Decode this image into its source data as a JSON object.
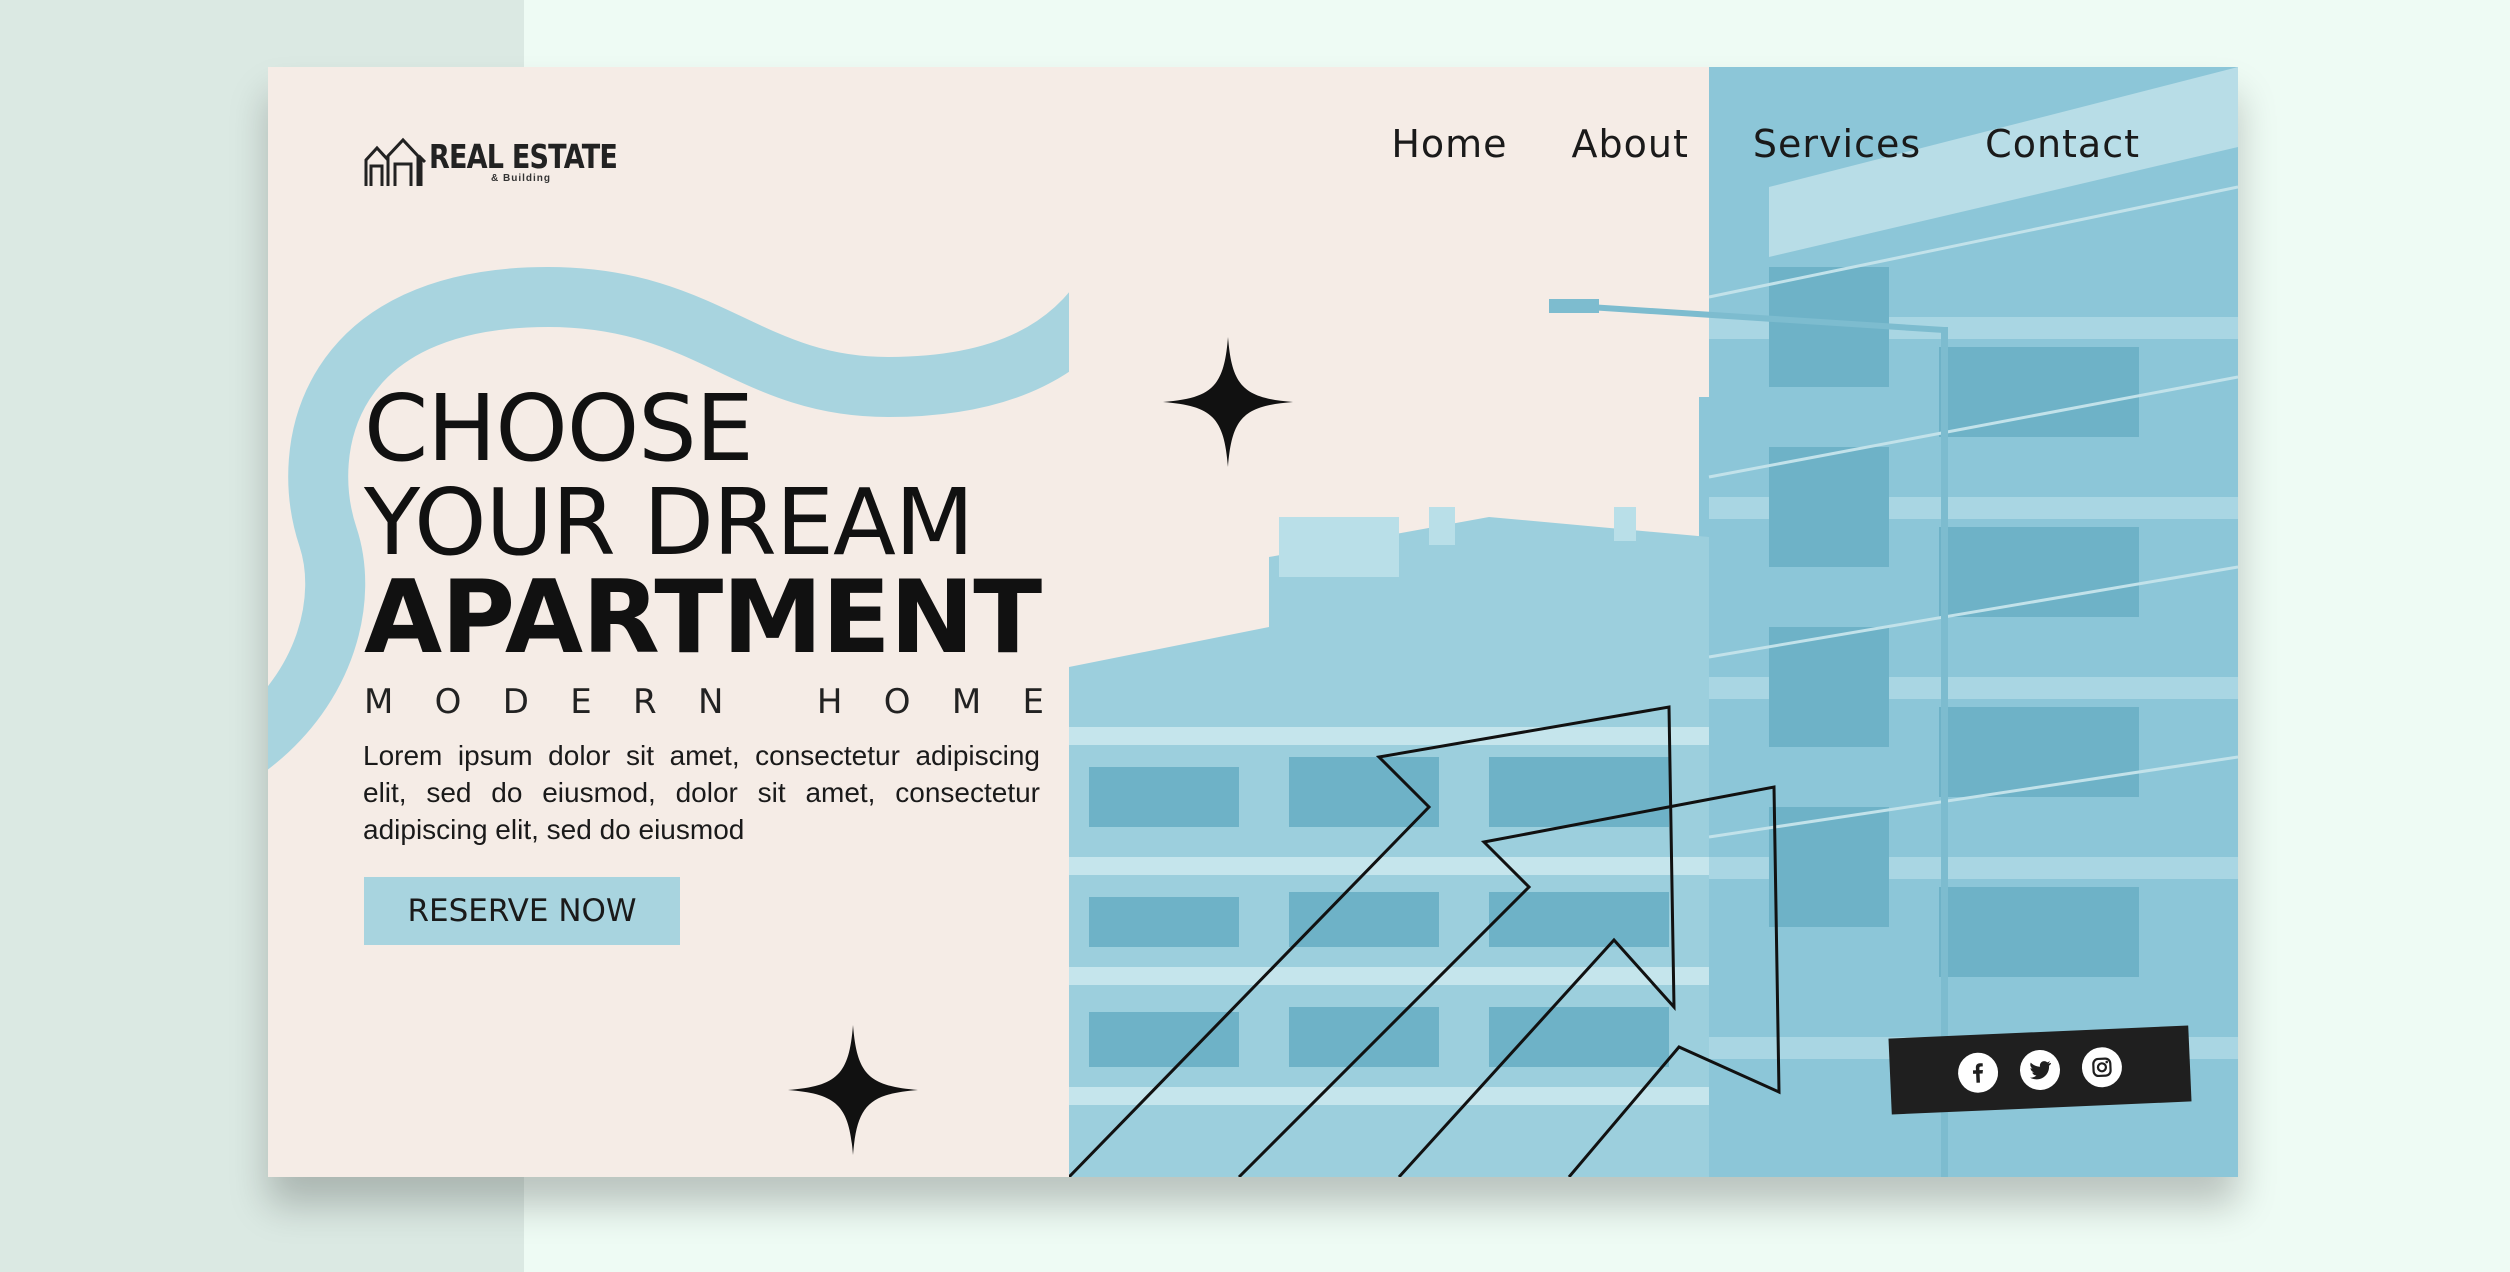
{
  "logo": {
    "title": "REAL ESTATE",
    "subtitle": "& Building"
  },
  "nav": {
    "items": [
      "Home",
      "About",
      "Services",
      "Contact"
    ]
  },
  "hero": {
    "line1": "CHOOSE",
    "line2": "YOUR DREAM",
    "line3": "APARTMENT",
    "subheading_words": [
      "MODERN",
      "HOME"
    ],
    "body": "Lorem ipsum dolor sit amet, consectetur adipiscing elit, sed do eiusmod, dolor sit amet, consectetur adipiscing elit, sed do eiusmod",
    "cta_label": "RESERVE NOW"
  },
  "social": {
    "icons": [
      "facebook-icon",
      "twitter-icon",
      "instagram-icon"
    ]
  },
  "colors": {
    "background": "#eefbf4",
    "left_strip": "#dbe9e3",
    "page": "#f5ece6",
    "accent": "#a8d4df",
    "building": "#8cc6d8",
    "dark": "#1f1f1f"
  }
}
